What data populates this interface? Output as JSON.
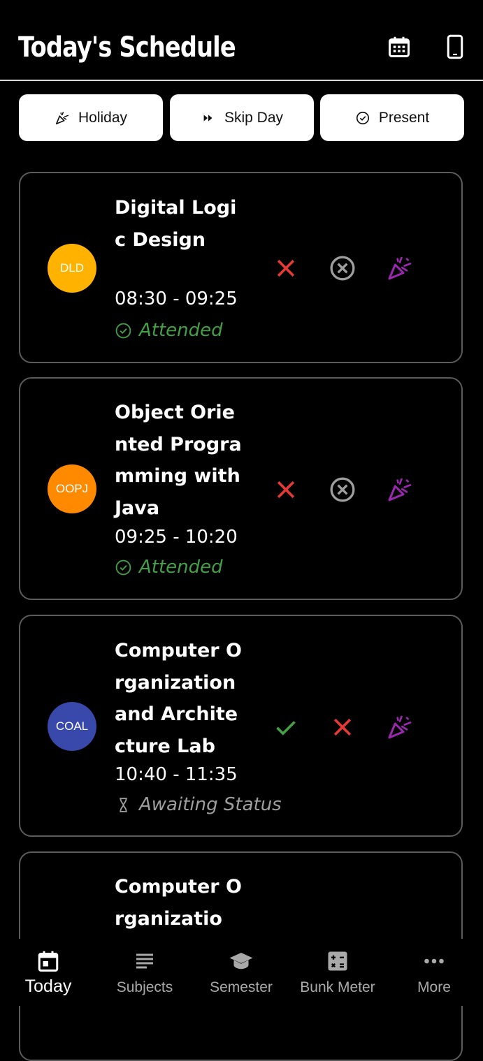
{
  "header": {
    "title": "Today's Schedule",
    "calendar_icon": "calendar-icon",
    "device_icon": "smartphone-icon"
  },
  "actions": [
    {
      "label": "Holiday",
      "icon": "party-popper-icon"
    },
    {
      "label": "Skip Day",
      "icon": "fast-forward-icon"
    },
    {
      "label": "Present",
      "icon": "check-circle-icon"
    }
  ],
  "classes": [
    {
      "code": "DLD",
      "name": "Digital Logic Design",
      "time": "08:30 - 09:25",
      "status": "Attended",
      "color": "#FFB300"
    },
    {
      "code": "OOPJ",
      "name": "Object Oriented Programming with Java",
      "time": "09:25 - 10:20",
      "status": "Attended",
      "color": "#FF8A00"
    },
    {
      "code": "COAL",
      "name": "Computer Organization and Architecture Lab",
      "time": "10:40 - 11:35",
      "status": "Awaiting Status",
      "color": "#3949AB"
    },
    {
      "code": "",
      "name": "Computer Organizatio"
    }
  ],
  "colors": {
    "attended": "#43A047",
    "awaiting": "#9E9E9E",
    "absent": "#E53935",
    "cancel": "#9E9E9E",
    "holiday": "#9C27B0",
    "present_check": "#43A047"
  },
  "nav": [
    {
      "label": "Today",
      "icon": "today-calendar-icon",
      "active": true
    },
    {
      "label": "Subjects",
      "icon": "list-icon"
    },
    {
      "label": "Semester",
      "icon": "graduation-cap-icon"
    },
    {
      "label": "Bunk Meter",
      "icon": "calculator-icon"
    },
    {
      "label": "More",
      "icon": "more-dots-icon"
    }
  ]
}
